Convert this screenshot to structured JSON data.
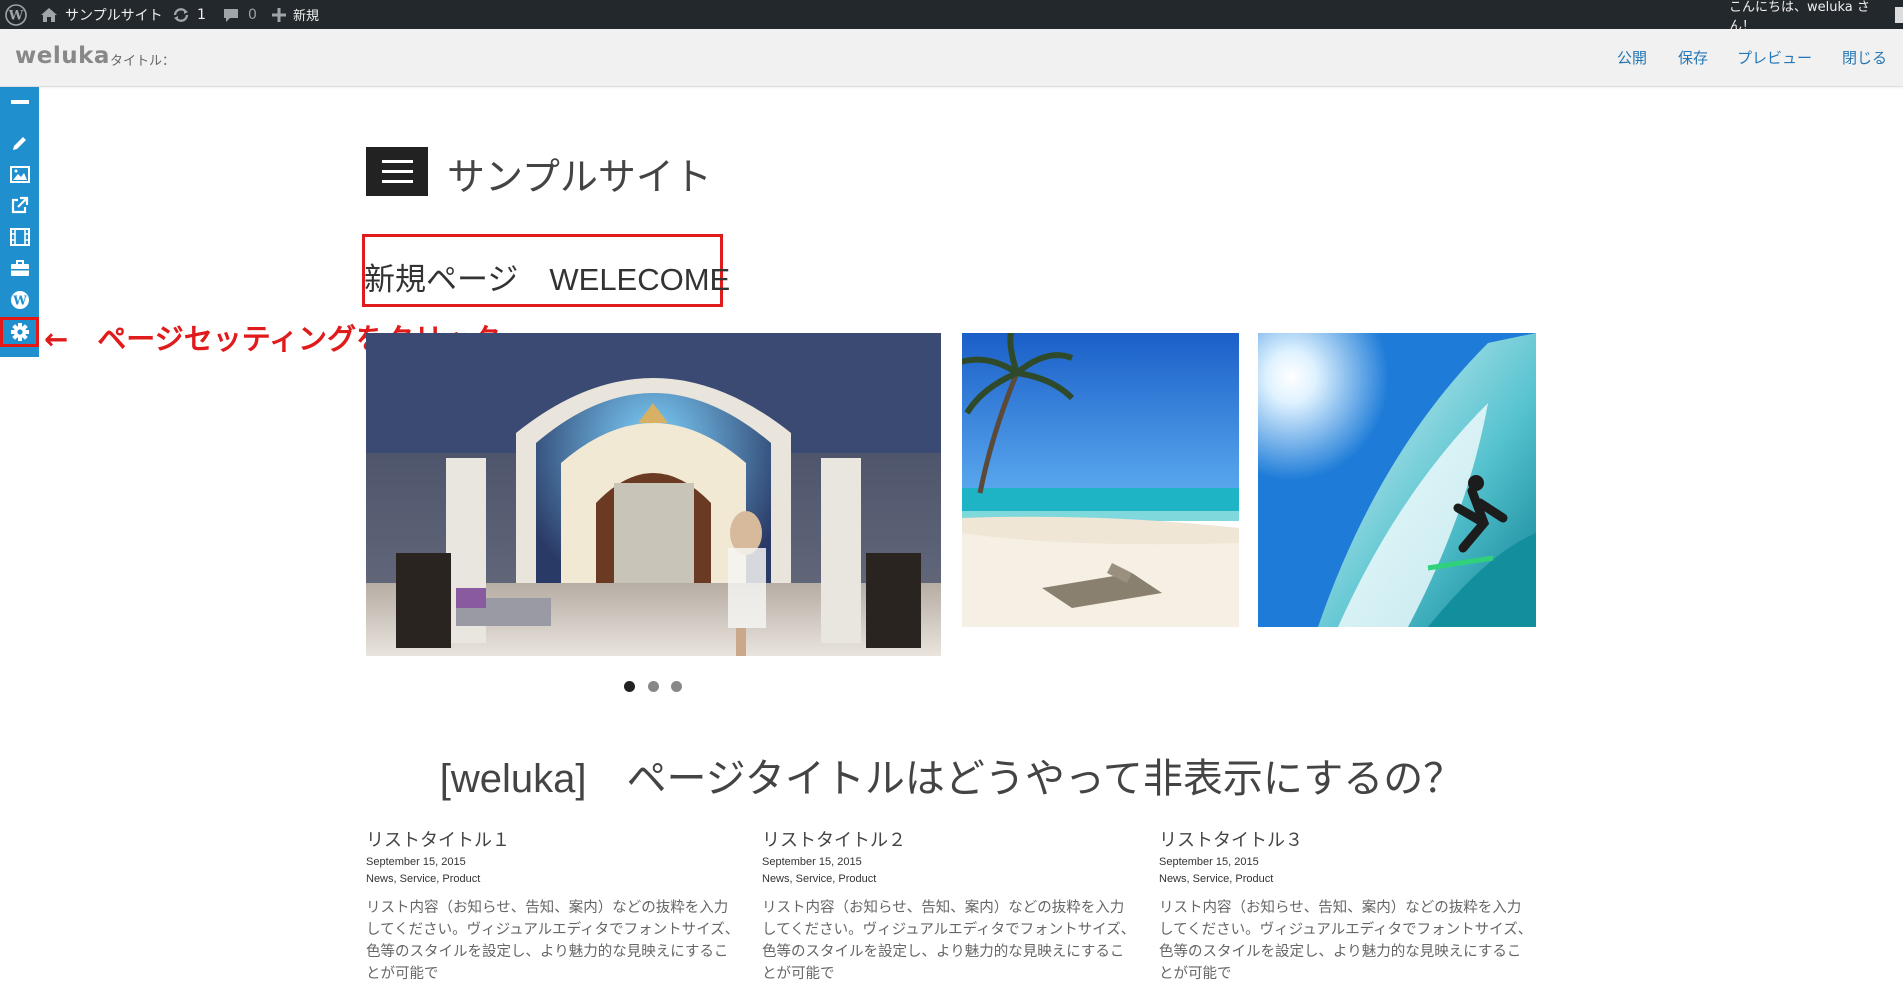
{
  "adminbar": {
    "site_name": "サンプルサイト",
    "updates_count": "1",
    "comments_count": "0",
    "new_label": "新規",
    "greeting": "こんにちは、weluka さん！"
  },
  "toolbar": {
    "logo": "weluka",
    "title_label": "タイトル：",
    "publish": "公開",
    "save": "保存",
    "preview": "プレビュー",
    "close": "閉じる"
  },
  "sidebar": {
    "icons": [
      "minimize-icon",
      "pencil-icon",
      "image-icon",
      "external-link-icon",
      "film-icon",
      "briefcase-icon",
      "wordpress-icon",
      "gear-icon"
    ]
  },
  "annotation": {
    "text": "←　ページセッティングをクリック",
    "color": "#e01b1b"
  },
  "site": {
    "name": "サンプルサイト"
  },
  "page": {
    "title": "新規ページ　WELECOME",
    "post_title": "[weluka]　ページタイトルはどうやって非表示にするの？"
  },
  "slider": {
    "slides_count": 3,
    "active_index": 0
  },
  "list": [
    {
      "title": "リストタイトル１",
      "date": "September 15, 2015",
      "categories": "News, Service, Product",
      "excerpt": "リスト内容（お知らせ、告知、案内）などの抜粋を入力してください。ヴィジュアルエディタでフォントサイズ、色等のスタイルを設定し、より魅力的な見映えにすることが可能で"
    },
    {
      "title": "リストタイトル２",
      "date": "September 15, 2015",
      "categories": "News, Service, Product",
      "excerpt": "リスト内容（お知らせ、告知、案内）などの抜粋を入力してください。ヴィジュアルエディタでフォントサイズ、色等のスタイルを設定し、より魅力的な見映えにすることが可能で"
    },
    {
      "title": "リストタイトル３",
      "date": "September 15, 2015",
      "categories": "News, Service, Product",
      "excerpt": "リスト内容（お知らせ、告知、案内）などの抜粋を入力してください。ヴィジュアルエディタでフォントサイズ、色等のスタイルを設定し、より魅力的な見映えにすることが可能で"
    }
  ]
}
